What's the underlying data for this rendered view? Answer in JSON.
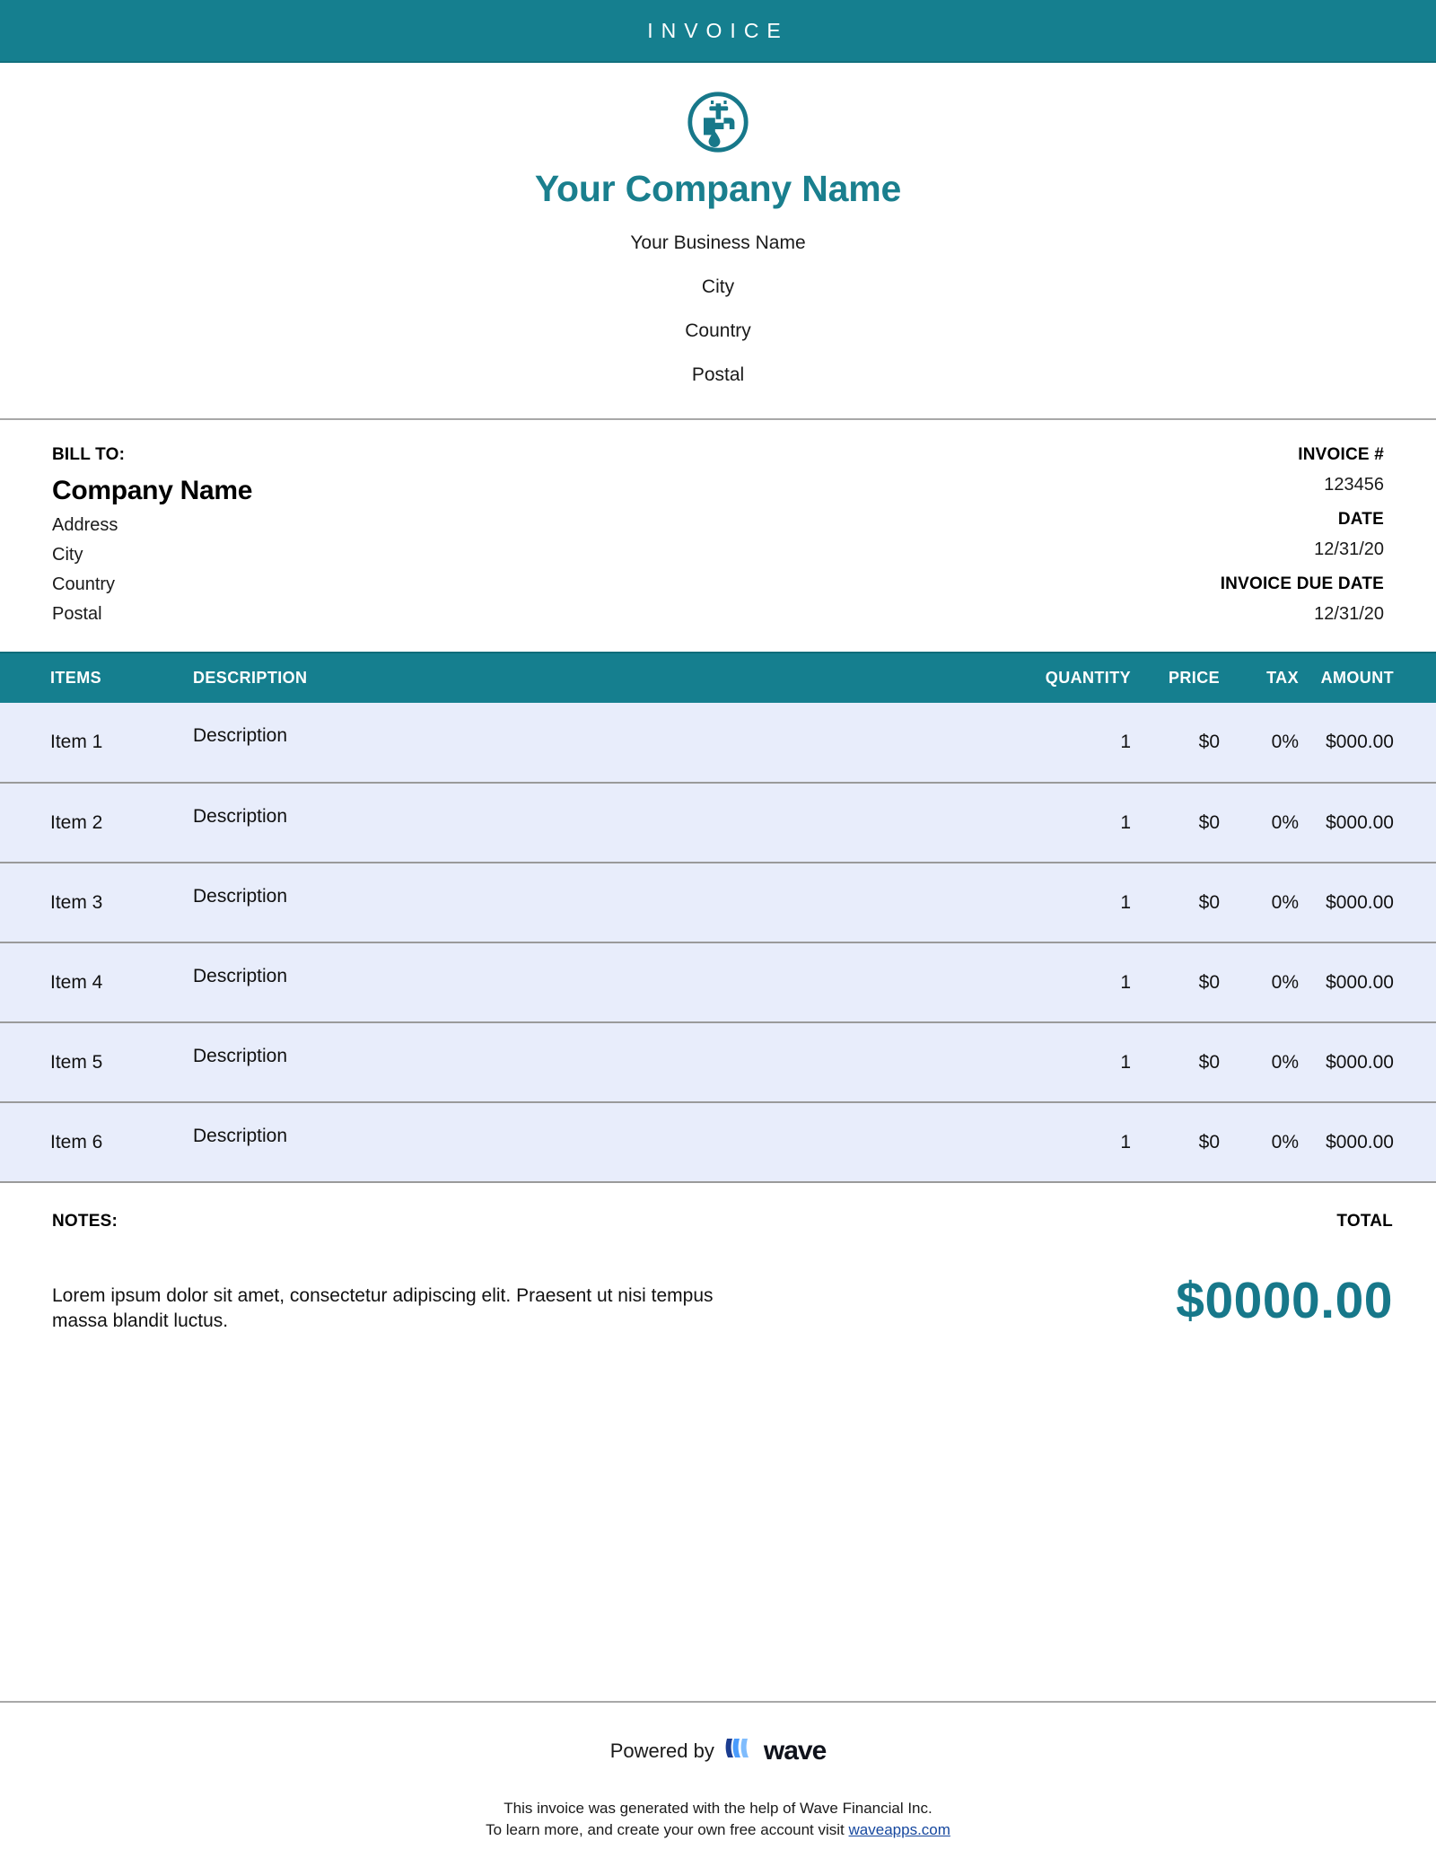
{
  "header": {
    "title": "INVOICE",
    "bar_color": "#157f8f"
  },
  "company": {
    "logo_icon": "faucet-in-circle-icon",
    "name": "Your Company Name",
    "name_color": "#1a7f8e",
    "lines": [
      "Your Business Name",
      "City",
      "Country",
      "Postal"
    ]
  },
  "bill_to": {
    "label": "BILL TO:",
    "company": "Company Name",
    "lines": [
      "Address",
      "City",
      "Country",
      "Postal"
    ]
  },
  "invoice_meta": {
    "number_label": "INVOICE #",
    "number_value": "123456",
    "date_label": "DATE",
    "date_value": "12/31/20",
    "due_label": "INVOICE DUE DATE",
    "due_value": "12/31/20"
  },
  "items_table": {
    "columns": {
      "items": "ITEMS",
      "description": "DESCRIPTION",
      "quantity": "QUANTITY",
      "price": "PRICE",
      "tax": "TAX",
      "amount": "AMOUNT"
    },
    "header_bg": "#157f8f",
    "row_bg": "#e8edfb",
    "rows": [
      {
        "item": "Item 1",
        "description": "Description",
        "quantity": "1",
        "price": "$0",
        "tax": "0%",
        "amount": "$000.00"
      },
      {
        "item": "Item 2",
        "description": "Description",
        "quantity": "1",
        "price": "$0",
        "tax": "0%",
        "amount": "$000.00"
      },
      {
        "item": "Item 3",
        "description": "Description",
        "quantity": "1",
        "price": "$0",
        "tax": "0%",
        "amount": "$000.00"
      },
      {
        "item": "Item 4",
        "description": "Description",
        "quantity": "1",
        "price": "$0",
        "tax": "0%",
        "amount": "$000.00"
      },
      {
        "item": "Item 5",
        "description": "Description",
        "quantity": "1",
        "price": "$0",
        "tax": "0%",
        "amount": "$000.00"
      },
      {
        "item": "Item 6",
        "description": "Description",
        "quantity": "1",
        "price": "$0",
        "tax": "0%",
        "amount": "$000.00"
      }
    ]
  },
  "notes": {
    "label": "NOTES:",
    "body": "Lorem ipsum dolor sit amet, consectetur adipiscing elit. Praesent ut nisi tempus massa blandit luctus."
  },
  "total": {
    "label": "TOTAL",
    "amount": "$0000.00",
    "amount_color": "#17788a"
  },
  "footer": {
    "powered_by": "Powered by",
    "brand": "wave",
    "brand_icon": "wave-logo-icon",
    "legal_line1": "This invoice was generated with the help of Wave Financial Inc.",
    "legal_line2_prefix": "To learn more, and create your own free account visit ",
    "legal_link": "waveapps.com"
  }
}
